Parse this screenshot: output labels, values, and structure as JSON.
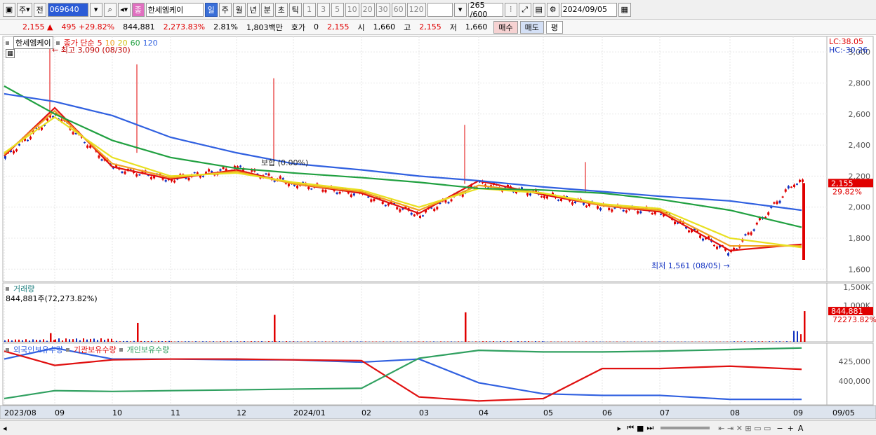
{
  "toolbar": {
    "period_label": "주",
    "prev_label": "전",
    "code": "069640",
    "stock_name": "한세엠케이",
    "tabs": [
      "일",
      "주",
      "월",
      "년",
      "분",
      "초",
      "틱"
    ],
    "active_tab": "일",
    "intervals": [
      "1",
      "3",
      "5",
      "10",
      "20",
      "30",
      "60",
      "120"
    ],
    "range": "265 /600",
    "date": "2024/09/05"
  },
  "quote": {
    "price": "2,155",
    "change": "495 +29.82%",
    "volume": "844,881",
    "volume_ratio": "2,273.83%",
    "turnover": "2.81%",
    "amount": "1,803백만",
    "hoga_label": "호가",
    "hoga_value": "0",
    "hoga_price": "2,155",
    "open_label": "시",
    "open": "1,660",
    "high_label": "고",
    "high": "2,155",
    "low_label": "저",
    "low": "1,660",
    "buy_label": "매수",
    "sell_label": "매도",
    "flat_label": "평"
  },
  "price_panel": {
    "name_box": "한세엠케이",
    "legend_prefix": "종가 단순",
    "ma_labels": [
      "5",
      "10",
      "20",
      "60",
      "120"
    ],
    "ma_colors": [
      "#e01010",
      "#f0a020",
      "#e8e020",
      "#20a040",
      "#3060e0"
    ],
    "annotation_high": "최고 3,090 (08/30)",
    "annotation_low": "최저 1,561 (08/05)",
    "annotation_flat": "보합 (0.00%)",
    "lc_label": "LC:38.05",
    "hc_label": "HC:-30.26",
    "last_price_tag": "2,155",
    "last_pct_tag": "29.82%",
    "y_ticks": [
      "3,000",
      "2,800",
      "2,600",
      "2,400",
      "2,200",
      "2,000",
      "1,800",
      "1,600"
    ]
  },
  "volume_panel": {
    "title": "거래량",
    "value_text": "844,881주(72,273.82%)",
    "y_ticks": [
      "1,500K",
      "1,000K"
    ],
    "last_tag": "844,881",
    "last_pct_tag": "72273.82%"
  },
  "holding_panel": {
    "legend": [
      "외국인보유수량",
      "기관보유수량",
      "개인보유수량"
    ],
    "colors": [
      "#3060e0",
      "#e01010",
      "#30a060"
    ],
    "y_ticks": [
      "425,000",
      "400,000"
    ]
  },
  "x_axis": {
    "labels": [
      "2023/08",
      "09",
      "10",
      "11",
      "12",
      "2024/01",
      "02",
      "03",
      "04",
      "05",
      "06",
      "07",
      "08",
      "09",
      "09/05"
    ]
  },
  "chart_data": [
    {
      "type": "line",
      "title": "한세엠케이",
      "x": [
        "2023/08",
        "09",
        "10",
        "11",
        "12",
        "2024/01",
        "02",
        "03",
        "04",
        "05",
        "06",
        "07",
        "08",
        "09"
      ],
      "ylim": [
        1520,
        3100
      ],
      "series": [
        {
          "name": "종가",
          "values": [
            2320,
            2600,
            2250,
            2180,
            2250,
            2150,
            2080,
            1950,
            2150,
            2080,
            2000,
            1970,
            1700,
            2155
          ]
        },
        {
          "name": "5",
          "values": [
            2330,
            2640,
            2260,
            2180,
            2240,
            2150,
            2090,
            1960,
            2170,
            2080,
            2010,
            1970,
            1720,
            1760
          ]
        },
        {
          "name": "10",
          "values": [
            2340,
            2620,
            2280,
            2190,
            2230,
            2150,
            2100,
            1980,
            2140,
            2090,
            2010,
            1980,
            1750,
            1750
          ]
        },
        {
          "name": "20",
          "values": [
            2350,
            2580,
            2320,
            2200,
            2220,
            2160,
            2110,
            2000,
            2120,
            2090,
            2020,
            1990,
            1800,
            1740
          ]
        },
        {
          "name": "60",
          "values": [
            2780,
            2600,
            2430,
            2320,
            2250,
            2220,
            2190,
            2160,
            2120,
            2110,
            2090,
            2050,
            1980,
            1870
          ]
        },
        {
          "name": "120",
          "values": [
            2730,
            2680,
            2590,
            2450,
            2350,
            2280,
            2240,
            2200,
            2170,
            2130,
            2100,
            2070,
            2040,
            1980
          ]
        }
      ]
    },
    {
      "type": "bar",
      "title": "거래량",
      "x": [
        "2023/08",
        "09",
        "10",
        "11",
        "12",
        "2024/01",
        "02",
        "03",
        "04",
        "05",
        "06",
        "07",
        "08",
        "09"
      ],
      "ylim": [
        0,
        1500000
      ],
      "series": [
        {
          "name": "거래량",
          "values": [
            180000,
            240000,
            60000,
            40000,
            45000,
            30000,
            25000,
            30000,
            45000,
            25000,
            20000,
            20000,
            40000,
            844881
          ]
        }
      ],
      "spikes": [
        {
          "x": "08/30",
          "value": 240000
        },
        {
          "x": "10/19",
          "value": 520000
        },
        {
          "x": "12/20",
          "value": 740000
        },
        {
          "x": "03/27",
          "value": 810000
        },
        {
          "x": "09/05",
          "value": 844881
        }
      ]
    },
    {
      "type": "line",
      "title": "보유수량",
      "x": [
        "2023/08",
        "09",
        "10",
        "11",
        "12",
        "2024/01",
        "02",
        "03",
        "04",
        "05",
        "06",
        "07",
        "08",
        "09"
      ],
      "series": [
        {
          "name": "외국인보유수량",
          "values": [
            428000,
            442000,
            428000,
            428000,
            427000,
            427000,
            424000,
            428000,
            398000,
            384000,
            382000,
            382000,
            377000,
            377000
          ]
        },
        {
          "name": "기관보유수량",
          "values": [
            438000,
            420000,
            427000,
            428000,
            428000,
            427000,
            426000,
            380000,
            375000,
            378000,
            416000,
            416000,
            419000,
            415000
          ]
        },
        {
          "name": "개인보유수량",
          "values": [
            378000,
            388000,
            387000,
            388000,
            389000,
            390000,
            391000,
            429000,
            439000,
            437000,
            437000,
            438000,
            440000,
            442000
          ]
        }
      ]
    }
  ]
}
